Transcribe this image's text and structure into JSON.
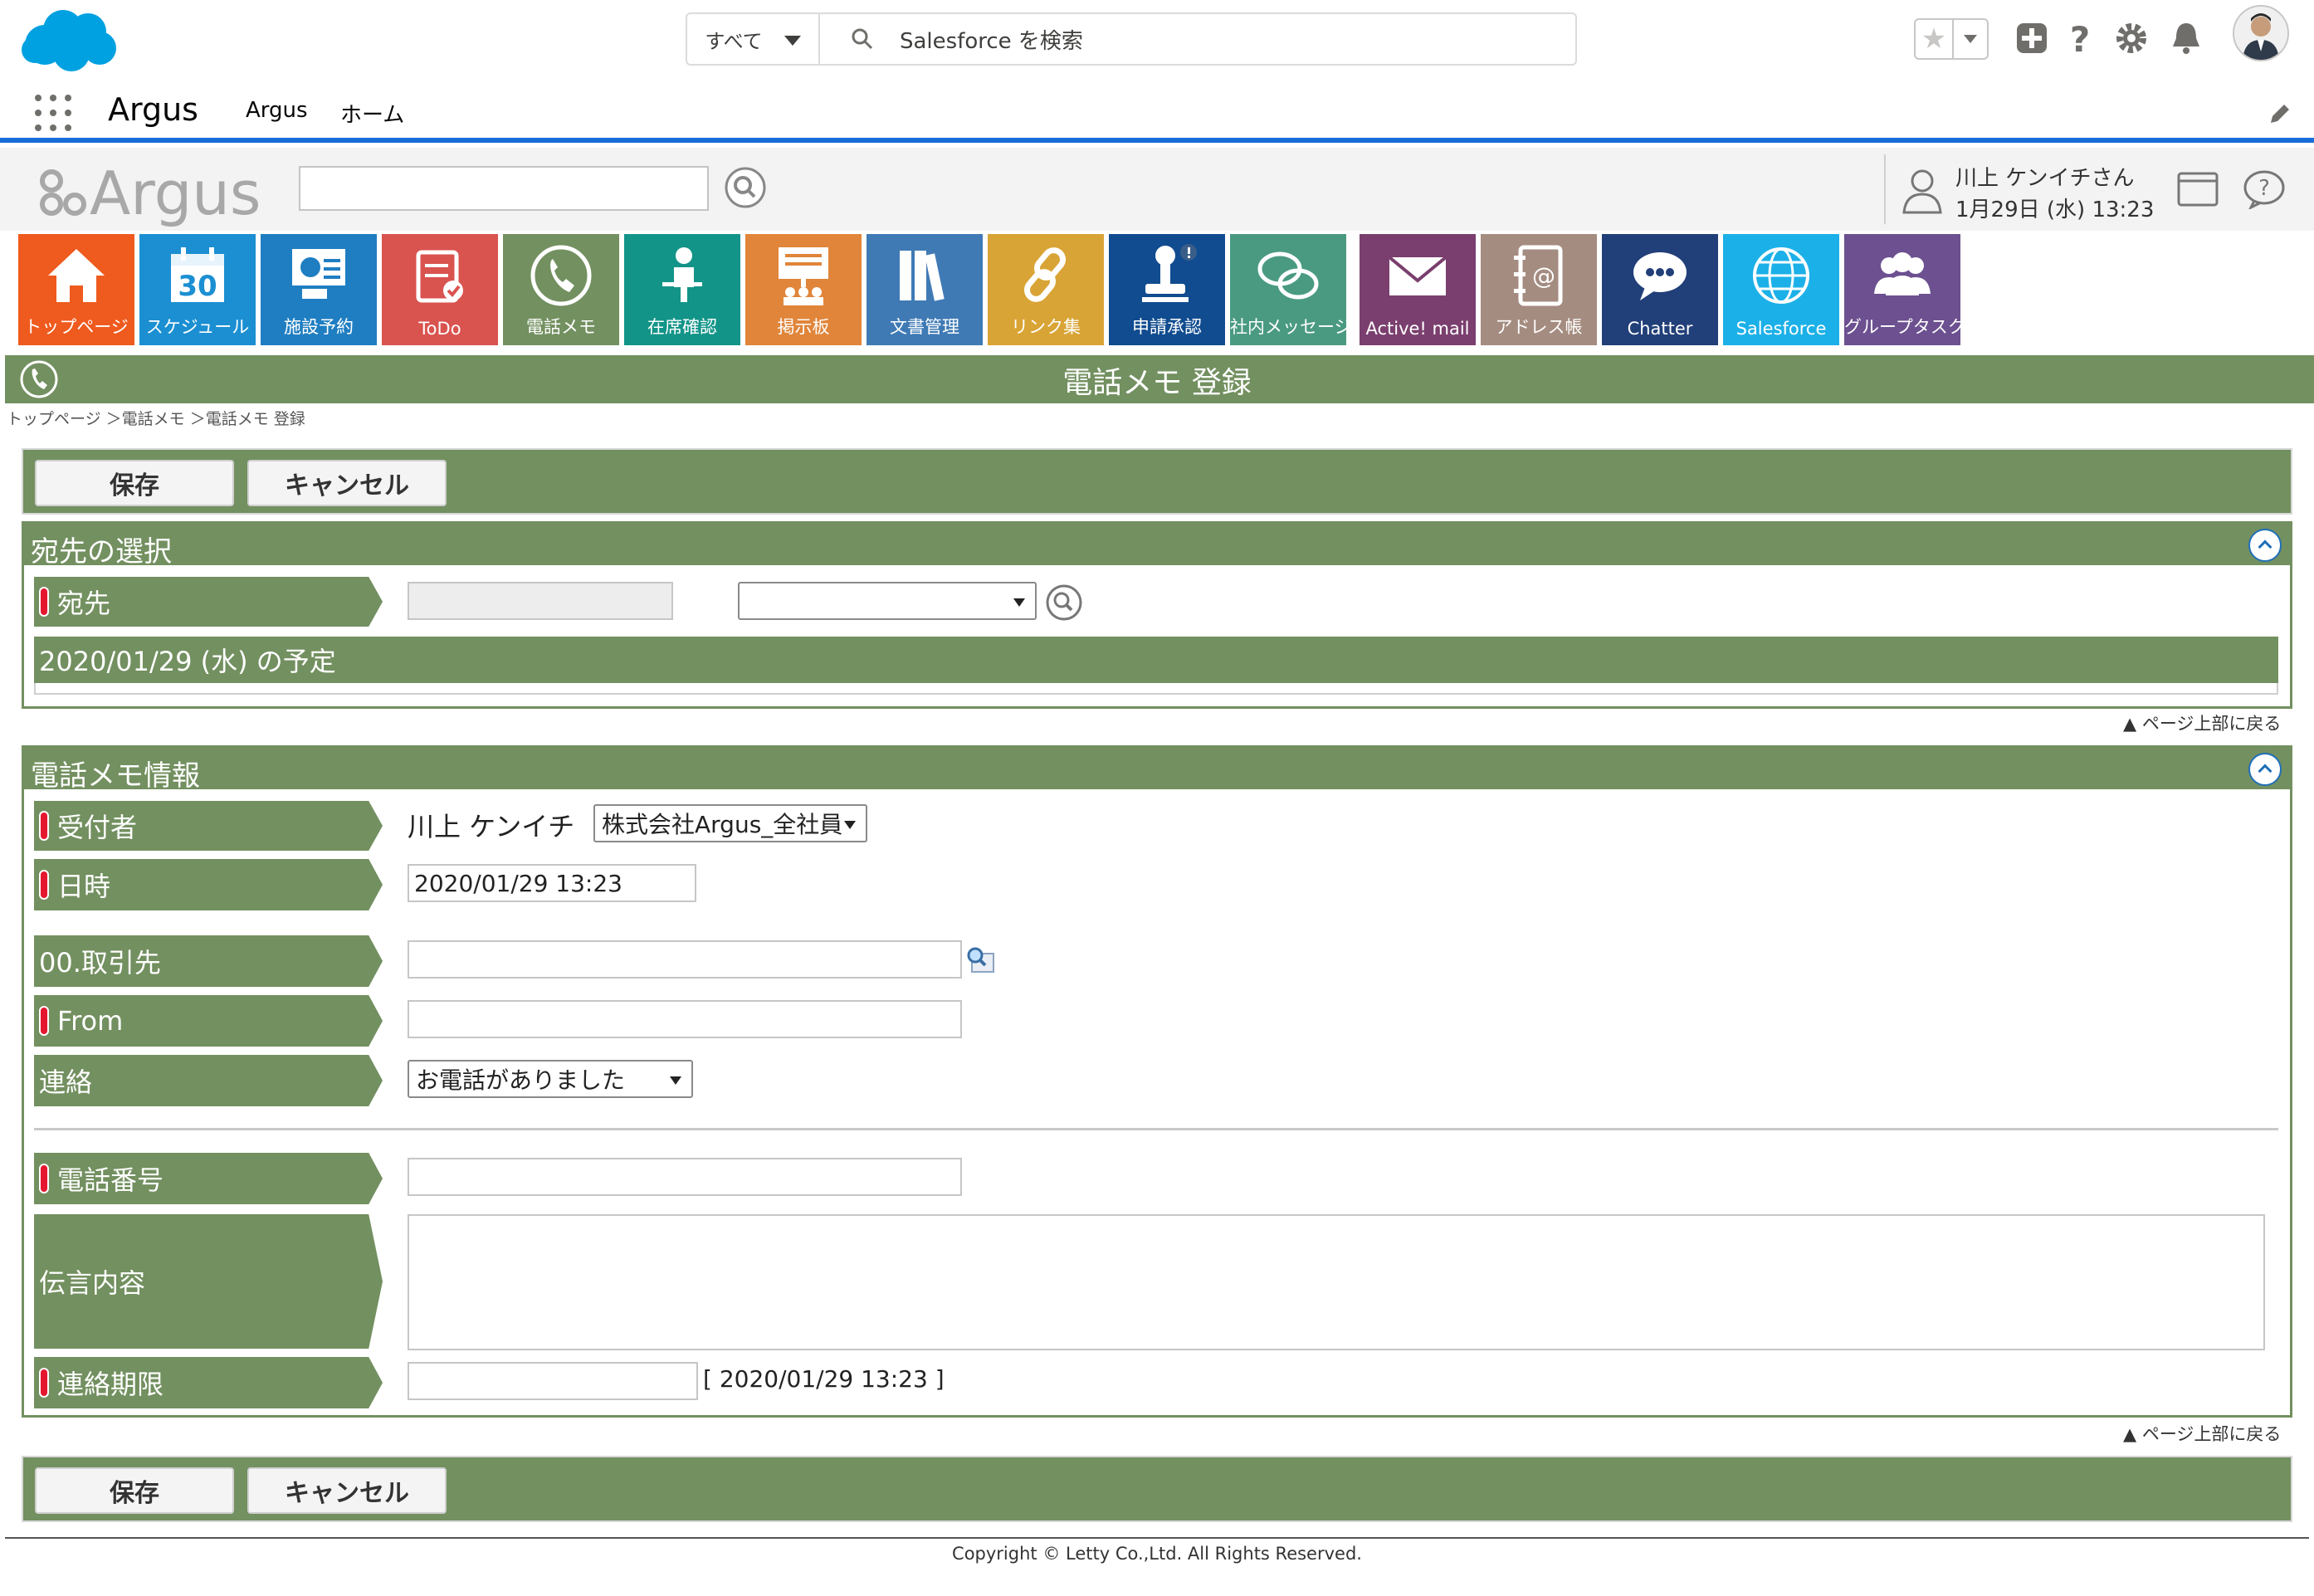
{
  "salesforce": {
    "search_scope": "すべて",
    "search_placeholder": "Salesforce を検索",
    "app_name": "Argus",
    "nav_items": [
      "Argus",
      "ホーム"
    ],
    "brand_color": "#00a1e0",
    "nav_accent": "#1a6dd8"
  },
  "argus": {
    "logo_text": "Argus",
    "user_name": "川上 ケンイチさん",
    "user_datetime": "1月29日 (水) 13:23"
  },
  "tiles": [
    {
      "label": "トップページ",
      "color": "#ef5a1e",
      "icon": "home-icon"
    },
    {
      "label": "スケジュール",
      "color": "#1b8fd2",
      "icon": "calendar-icon",
      "number": "30"
    },
    {
      "label": "施設予約",
      "color": "#1f7ec2",
      "icon": "facility-icon"
    },
    {
      "label": "ToDo",
      "color": "#d9534f",
      "icon": "todo-icon"
    },
    {
      "label": "電話メモ",
      "color": "#739060",
      "icon": "phone-icon"
    },
    {
      "label": "在席確認",
      "color": "#139488",
      "icon": "presence-icon"
    },
    {
      "label": "掲示板",
      "color": "#e0853a",
      "icon": "board-icon"
    },
    {
      "label": "文書管理",
      "color": "#3f7ab5",
      "icon": "documents-icon"
    },
    {
      "label": "リンク集",
      "color": "#d9a436",
      "icon": "link-icon"
    },
    {
      "label": "申請承認",
      "color": "#104c8f",
      "icon": "stamp-icon"
    },
    {
      "label": "社内メッセージ",
      "color": "#4a9a82",
      "icon": "message-icon"
    },
    {
      "label": "Active! mail",
      "color": "#7a3f6e",
      "icon": "mail-icon"
    },
    {
      "label": "アドレス帳",
      "color": "#a58c80",
      "icon": "address-book-icon"
    },
    {
      "label": "Chatter",
      "color": "#213f78",
      "icon": "chatter-icon"
    },
    {
      "label": "Salesforce",
      "color": "#1cb0e8",
      "icon": "globe-icon"
    },
    {
      "label": "グループタスク",
      "color": "#6c5090",
      "icon": "group-icon"
    }
  ],
  "page": {
    "title": "電話メモ 登録",
    "breadcrumb": "トップページ ＞電話メモ ＞電話メモ 登録",
    "theme_color": "#739060",
    "save_label": "保存",
    "cancel_label": "キャンセル",
    "back_to_top": "▲ ページ上部に戻る"
  },
  "recipient_section": {
    "title": "宛先の選択",
    "recipient_label": "宛先",
    "recipient_value": "",
    "recipient_select": "",
    "schedule_header": "2020/01/29 (水) の予定"
  },
  "memo_section": {
    "title": "電話メモ情報",
    "receiver_label": "受付者",
    "receiver_name": "川上 ケンイチ",
    "receiver_group": "株式会社Argus_全社員",
    "datetime_label": "日時",
    "datetime_value": "2020/01/29 13:23",
    "client_label": "00.取引先",
    "client_value": "",
    "from_label": "From",
    "from_value": "",
    "contact_label": "連絡",
    "contact_value": "お電話がありました",
    "phone_label": "電話番号",
    "phone_value": "",
    "message_label": "伝言内容",
    "message_value": "",
    "deadline_label": "連絡期限",
    "deadline_value": "",
    "deadline_hint": "[ 2020/01/29 13:23 ]"
  },
  "footer": {
    "copyright": "Copyright © Letty Co.,Ltd. All Rights Reserved."
  }
}
